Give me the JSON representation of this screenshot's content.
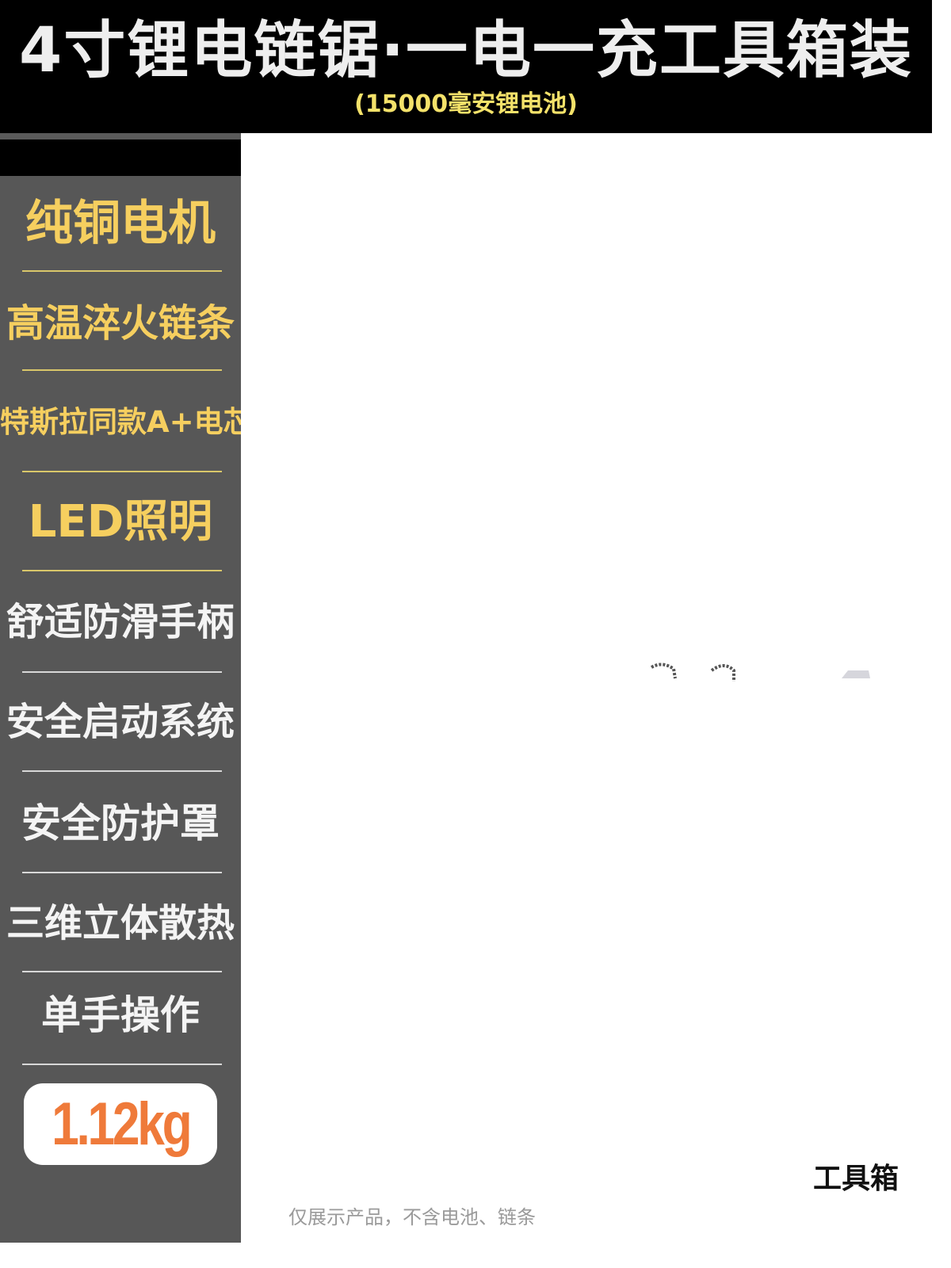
{
  "header": {
    "title": "4寸锂电链锯·一电一充工具箱装",
    "subtitle": "(15000毫安锂电池)"
  },
  "features": [
    {
      "label": "纯铜电机",
      "style": "gold"
    },
    {
      "label": "高温淬火链条",
      "style": "gold"
    },
    {
      "label": "特斯拉同款A+电芯",
      "style": "gold"
    },
    {
      "label": "LED照明",
      "style": "gold"
    },
    {
      "label": "舒适防滑手柄",
      "style": "white"
    },
    {
      "label": "安全启动系统",
      "style": "white"
    },
    {
      "label": "安全防护罩",
      "style": "white"
    },
    {
      "label": "三维立体散热",
      "style": "white"
    },
    {
      "label": "单手操作",
      "style": "white"
    }
  ],
  "weight": "1.12kg",
  "product": {
    "toolbox_label": "工具箱",
    "disclaimer": "仅展示产品，不含电池、链条"
  },
  "colors": {
    "gold": "#f6cf5f",
    "weight_orange": "#ef7a3a",
    "sidebar_bg": "#575757",
    "header_bg": "#000000"
  }
}
